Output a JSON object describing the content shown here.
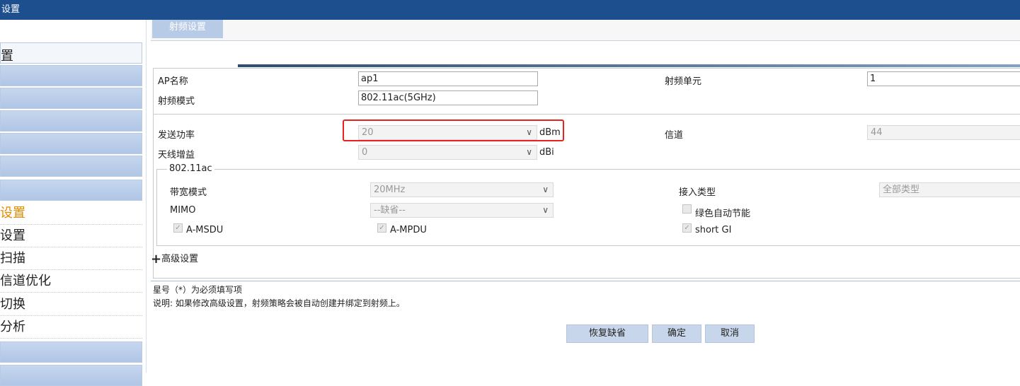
{
  "topbar": {
    "title": "设置"
  },
  "sidebar": {
    "header": "置",
    "links": [
      {
        "label": "设置",
        "active": true
      },
      {
        "label": "设置",
        "active": false
      },
      {
        "label": "扫描",
        "active": false
      },
      {
        "label": "信道优化",
        "active": false
      },
      {
        "label": "切换",
        "active": false
      },
      {
        "label": "分析",
        "active": false
      }
    ]
  },
  "tabs": {
    "active": "射频设置"
  },
  "form": {
    "ap_name": {
      "label": "AP名称",
      "value": "ap1"
    },
    "radio_unit": {
      "label": "射频单元",
      "value": "1"
    },
    "radio_mode": {
      "label": "射频模式",
      "value": "802.11ac(5GHz)"
    },
    "tx_power": {
      "label": "发送功率",
      "value": "20",
      "unit": "dBm"
    },
    "channel": {
      "label": "信道",
      "value": "44"
    },
    "antenna_gain": {
      "label": "天线增益",
      "value": "0",
      "unit": "dBi"
    },
    "group_80211ac": {
      "legend": "802.11ac",
      "bandwidth": {
        "label": "带宽模式",
        "value": "20MHz"
      },
      "access_type": {
        "label": "接入类型",
        "value": "全部类型"
      },
      "mimo": {
        "label": "MIMO",
        "value": "--缺省--"
      },
      "green_energy": {
        "label": "绿色自动节能",
        "checked": false
      },
      "amsdu": {
        "label": "A-MSDU",
        "checked": true
      },
      "ampdu": {
        "label": "A-MPDU",
        "checked": true
      },
      "short_gi": {
        "label": "short GI",
        "checked": true
      }
    },
    "advanced": {
      "plus": "+",
      "label": "高级设置"
    }
  },
  "notes": {
    "required": "星号（*）为必须填写项",
    "explain": "说明: 如果修改高级设置，射频策略会被自动创建并绑定到射频上。"
  },
  "buttons": {
    "restore": "恢复缺省",
    "ok": "确定",
    "cancel": "取消"
  },
  "colors": {
    "topbar": "#1d4f8f",
    "highlight": "#e8231c",
    "active_link": "#e68a00"
  }
}
